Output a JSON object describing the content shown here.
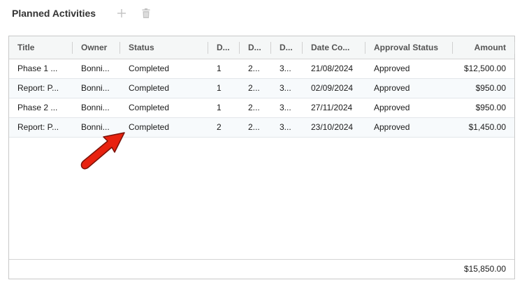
{
  "panel": {
    "title": "Planned Activities"
  },
  "toolbar": {
    "add_icon": "plus-icon",
    "delete_icon": "trash-icon",
    "icon_color": "#c4c4c4"
  },
  "grid": {
    "columns": [
      {
        "label": "Title"
      },
      {
        "label": "Owner"
      },
      {
        "label": "Status"
      },
      {
        "label": "D..."
      },
      {
        "label": "D..."
      },
      {
        "label": "D..."
      },
      {
        "label": "Date Co..."
      },
      {
        "label": "Approval Status"
      },
      {
        "label": "Amount"
      }
    ],
    "rows": [
      {
        "title": "Phase 1 ...",
        "owner": "Bonni...",
        "status": "Completed",
        "d1": "1",
        "d2": "2...",
        "d3": "3...",
        "date": "21/08/2024",
        "approval": "Approved",
        "amount": "$12,500.00"
      },
      {
        "title": "Report: P...",
        "owner": "Bonni...",
        "status": "Completed",
        "d1": "1",
        "d2": "2...",
        "d3": "3...",
        "date": "02/09/2024",
        "approval": "Approved",
        "amount": "$950.00"
      },
      {
        "title": "Phase 2 ...",
        "owner": "Bonni...",
        "status": "Completed",
        "d1": "1",
        "d2": "2...",
        "d3": "3...",
        "date": "27/11/2024",
        "approval": "Approved",
        "amount": "$950.00"
      },
      {
        "title": "Report: P...",
        "owner": "Bonni...",
        "status": "Completed",
        "d1": "2",
        "d2": "2...",
        "d3": "3...",
        "date": "23/10/2024",
        "approval": "Approved",
        "amount": "$1,450.00"
      }
    ],
    "footer_total": "$15,850.00"
  },
  "annotation": {
    "arrow_color": "#e8220f"
  }
}
